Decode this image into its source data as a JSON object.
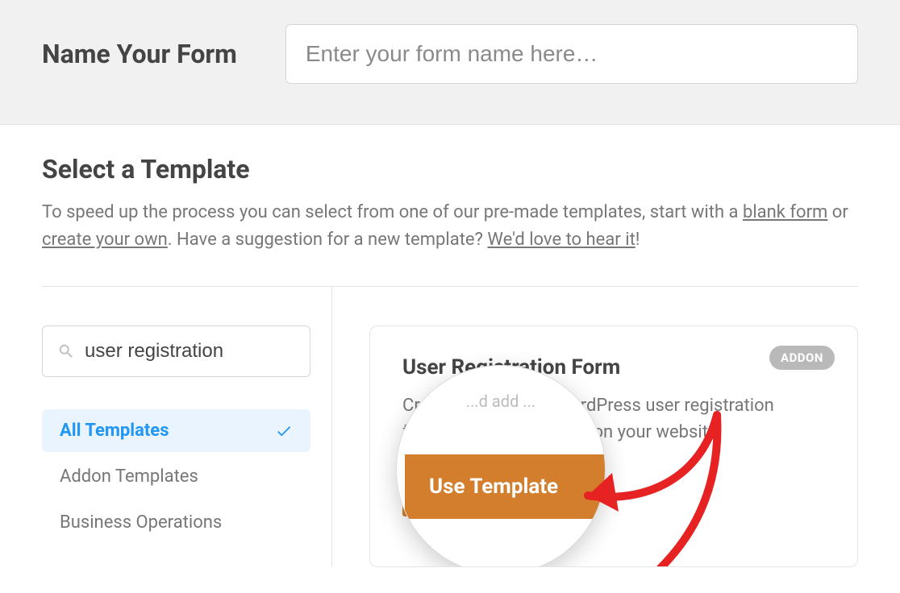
{
  "header": {
    "name_label": "Name Your Form",
    "name_placeholder": "Enter your form name here…"
  },
  "select_template": {
    "heading": "Select a Template",
    "desc_pre": "To speed up the process you can select from one of our pre-made templates, start with a ",
    "link_blank": "blank form",
    "desc_mid1": " or ",
    "link_create": "create your own",
    "desc_mid2": ". Have a suggestion for a new template? ",
    "link_hear": "We'd love to hear it",
    "desc_post": "!"
  },
  "sidebar": {
    "search_value": "user registration",
    "categories": [
      {
        "label": "All Templates",
        "active": true
      },
      {
        "label": "Addon Templates",
        "active": false
      },
      {
        "label": "Business Operations",
        "active": false
      }
    ]
  },
  "card": {
    "badge": "ADDON",
    "title": "User Registration Form",
    "desc_line1": "Create customized WordPress user registration",
    "desc_line2": "form           d  add              m anywhere on your website.",
    "button": "Use Template"
  },
  "lens": {
    "snippet_line1": "...d add   ...",
    "button": "Use Template"
  }
}
